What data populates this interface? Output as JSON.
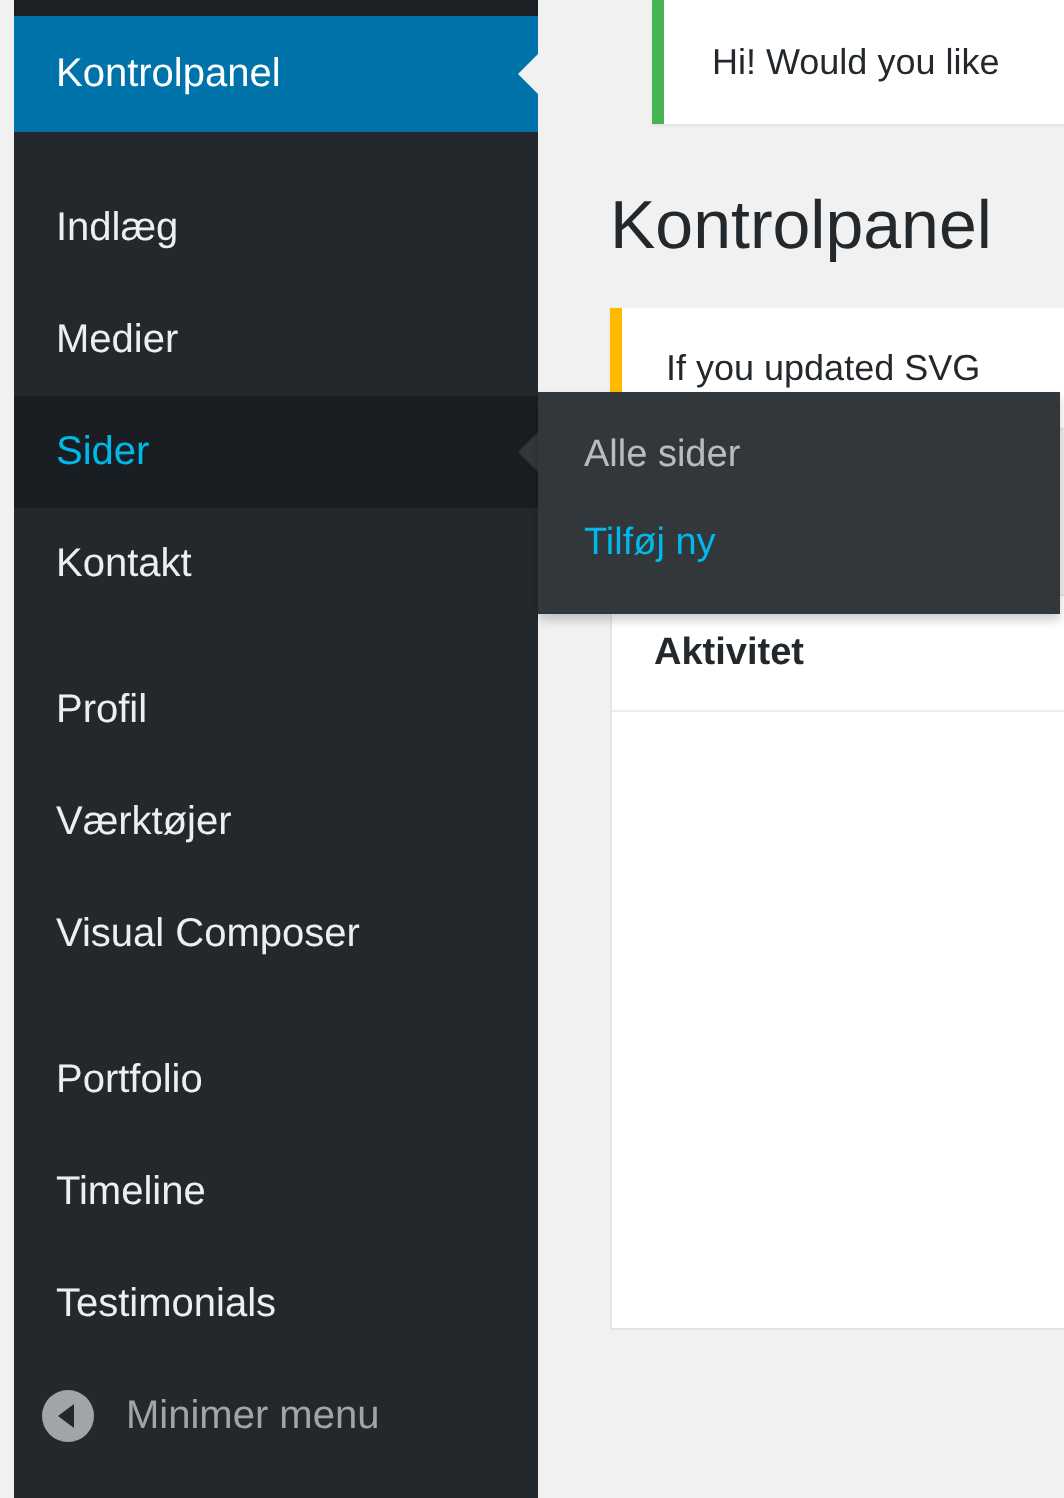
{
  "sidebar": {
    "groups": [
      {
        "items": [
          {
            "label": "Kontrolpanel",
            "selected": true,
            "highlighted": false
          }
        ]
      },
      {
        "items": [
          {
            "label": "Indlæg",
            "selected": false,
            "highlighted": false
          },
          {
            "label": "Medier",
            "selected": false,
            "highlighted": false
          },
          {
            "label": "Sider",
            "selected": false,
            "highlighted": true
          },
          {
            "label": "Kontakt",
            "selected": false,
            "highlighted": false
          }
        ]
      },
      {
        "items": [
          {
            "label": "Profil",
            "selected": false,
            "highlighted": false
          },
          {
            "label": "Værktøjer",
            "selected": false,
            "highlighted": false
          },
          {
            "label": "Visual Composer",
            "selected": false,
            "highlighted": false
          }
        ]
      },
      {
        "items": [
          {
            "label": "Portfolio",
            "selected": false,
            "highlighted": false
          },
          {
            "label": "Timeline",
            "selected": false,
            "highlighted": false
          },
          {
            "label": "Testimonials",
            "selected": false,
            "highlighted": false
          }
        ]
      }
    ],
    "collapse": {
      "label": "Minimer menu"
    }
  },
  "flyout": {
    "items": [
      {
        "label": "Alle sider",
        "highlighted": false
      },
      {
        "label": "Tilføj ny",
        "highlighted": true
      }
    ]
  },
  "notices": [
    {
      "text": "Hi! Would you like",
      "color": "#46b450"
    },
    {
      "text": "If you updated SVG",
      "color": "#ffb900"
    }
  ],
  "page_title": "Kontrolpanel",
  "widget": {
    "title": "Aktivitet"
  }
}
